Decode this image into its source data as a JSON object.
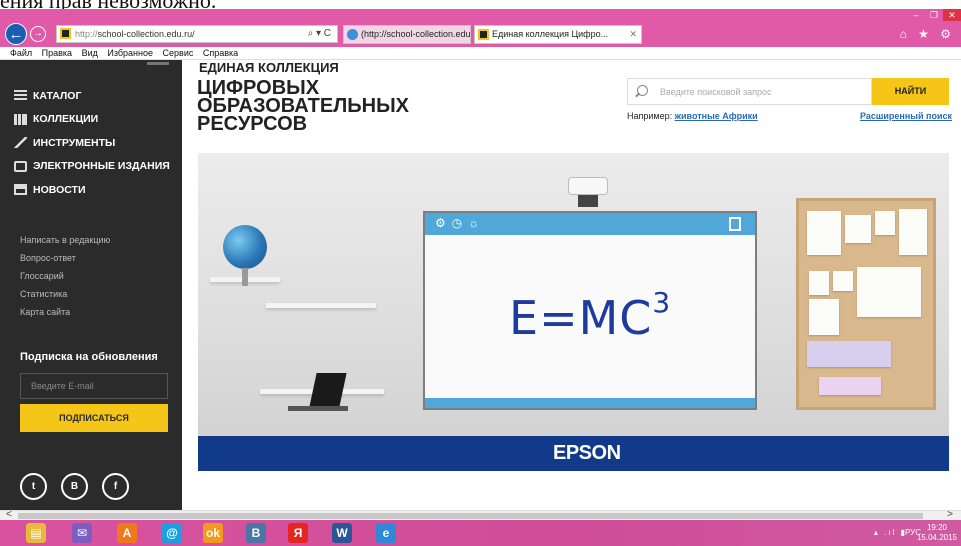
{
  "overlay_caption": "ения прав невозможно.",
  "window": {
    "minimize": "–",
    "restore": "❐",
    "close": "✕"
  },
  "browser": {
    "address_proto": "http://",
    "address_host": "school-collection.edu.ru/",
    "address_tools": "⌕ ▾ C",
    "tabs": [
      {
        "label": "(http://school-collection.edu.r...",
        "active": false
      },
      {
        "label": "Единая коллекция Цифро...",
        "active": true,
        "close": "✕"
      }
    ],
    "nav_right_icons": "⌂ ★ ⚙"
  },
  "menubar": [
    "Файл",
    "Правка",
    "Вид",
    "Избранное",
    "Сервис",
    "Справка"
  ],
  "sidebar": {
    "nav": [
      {
        "label": "КАТАЛОГ",
        "icon": "stack-icon"
      },
      {
        "label": "КОЛЛЕКЦИИ",
        "icon": "books-icon"
      },
      {
        "label": "ИНСТРУМЕНТЫ",
        "icon": "pen-icon"
      },
      {
        "label": "ЭЛЕКТРОННЫЕ ИЗДАНИЯ",
        "icon": "phone-icon"
      },
      {
        "label": "НОВОСТИ",
        "icon": "news-icon"
      }
    ],
    "links": [
      "Написать в редакцию",
      "Вопрос-ответ",
      "Глоссарий",
      "Статистика",
      "Карта сайта"
    ],
    "subscribe_title": "Подписка на обновления",
    "email_placeholder": "Введите E-mail",
    "subscribe_button": "ПОДПИСАТЬСЯ",
    "social": [
      "t",
      "B",
      "f"
    ]
  },
  "header": {
    "logo_sub": "ЕДИНАЯ КОЛЛЕКЦИЯ",
    "logo_main": "ЦИФРОВЫХ ОБРАЗОВАТЕЛЬНЫХ РЕСУРСОВ",
    "search_placeholder": "Введите поисковой запрос",
    "search_button": "НАЙТИ",
    "example_prefix": "Например:",
    "example_link": "животные Африки",
    "advanced_search": "Расширенный поиск"
  },
  "banner": {
    "formula": "E=MC",
    "formula_exp": "3",
    "board_tools": "⚙◷☼",
    "brand": "EPSON"
  },
  "taskbar": {
    "apps": [
      {
        "name": "explorer",
        "glyph": "▤",
        "color": "#e8b93a"
      },
      {
        "name": "mail",
        "glyph": "✉",
        "color": "#7a5fc0"
      },
      {
        "name": "avast",
        "glyph": "A",
        "color": "#f07a1a"
      },
      {
        "name": "mail-ru",
        "glyph": "@",
        "color": "#1aa0e0"
      },
      {
        "name": "odnoklassniki",
        "glyph": "ok",
        "color": "#f39a1a"
      },
      {
        "name": "vk",
        "glyph": "B",
        "color": "#4a76a8"
      },
      {
        "name": "yandex",
        "glyph": "Я",
        "color": "#e52620"
      },
      {
        "name": "word",
        "glyph": "W",
        "color": "#2b5797"
      },
      {
        "name": "ie",
        "glyph": "e",
        "color": "#2e8ad8"
      }
    ],
    "tray_icons": "▴ .ıl ▮",
    "language": "РУС",
    "time": "19:20",
    "date": "15.04.2015"
  },
  "scrollbar": {
    "left": "<",
    "right": ">"
  }
}
